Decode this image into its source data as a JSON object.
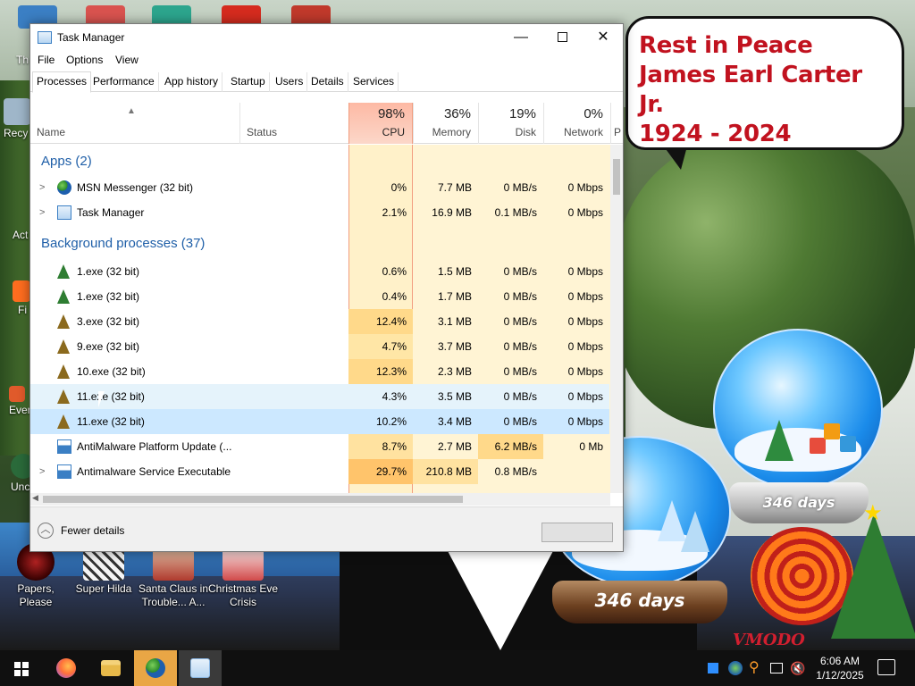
{
  "bubble": {
    "line1": "Rest in Peace",
    "line2": "James Earl Carter Jr.",
    "line3": "1924 - 2024"
  },
  "globes": {
    "left_label": "346 days",
    "right_label": "346 days"
  },
  "watermark": "VMODO",
  "desktop_icons": [
    {
      "label": "Papers, Please",
      "icon": "papers-please-icon",
      "color": "#8b0000"
    },
    {
      "label": "Super Hilda",
      "icon": "super-hilda-icon",
      "color": "#f4f4f4"
    },
    {
      "label": "Santa Claus in Trouble... A...",
      "icon": "santa-claus-icon",
      "color": "#b03a2e"
    },
    {
      "label": "Christmas Eve Crisis",
      "icon": "christmas-eve-icon",
      "color": "#d14a4a"
    }
  ],
  "left_icons": [
    {
      "label": "Th",
      "icon": "this-pc-icon"
    },
    {
      "label": "Recy",
      "icon": "recycle-bin-icon"
    },
    {
      "label": "Act",
      "icon": "activation-icon"
    },
    {
      "label": "Fi",
      "icon": "firefox-shortcut-icon"
    },
    {
      "label": "Ever",
      "icon": "everything-icon"
    },
    {
      "label": "Unc",
      "icon": "uncategorized-icon"
    }
  ],
  "window": {
    "title": "Task Manager",
    "menu": [
      "File",
      "Options",
      "View"
    ],
    "tabs": [
      "Processes",
      "Performance",
      "App history",
      "Startup",
      "Users",
      "Details",
      "Services"
    ],
    "active_tab": "Processes",
    "columns": {
      "name": "Name",
      "status": "Status",
      "cpu_pct": "98%",
      "cpu": "CPU",
      "mem_pct": "36%",
      "mem": "Memory",
      "disk_pct": "19%",
      "disk": "Disk",
      "net_pct": "0%",
      "net": "Network",
      "power": "P"
    },
    "groups": {
      "apps": "Apps (2)",
      "background": "Background processes (37)"
    },
    "apps": [
      {
        "name": "MSN Messenger (32 bit)",
        "cpu": "0%",
        "mem": "7.7 MB",
        "disk": "0 MB/s",
        "net": "0 Mbps",
        "icon": "msn-messenger-icon",
        "expandable": true
      },
      {
        "name": "Task Manager",
        "cpu": "2.1%",
        "mem": "16.9 MB",
        "disk": "0.1 MB/s",
        "net": "0 Mbps",
        "icon": "task-manager-icon",
        "expandable": true
      }
    ],
    "background": [
      {
        "name": "1.exe (32 bit)",
        "cpu": "0.6%",
        "mem": "1.5 MB",
        "disk": "0 MB/s",
        "net": "0 Mbps",
        "icon": "tree-icon",
        "expandable": false
      },
      {
        "name": "1.exe (32 bit)",
        "cpu": "0.4%",
        "mem": "1.7 MB",
        "disk": "0 MB/s",
        "net": "0 Mbps",
        "icon": "tree-icon",
        "expandable": false
      },
      {
        "name": "3.exe (32 bit)",
        "cpu": "12.4%",
        "mem": "3.1 MB",
        "disk": "0 MB/s",
        "net": "0 Mbps",
        "icon": "tree-icon",
        "expandable": false
      },
      {
        "name": "9.exe (32 bit)",
        "cpu": "4.7%",
        "mem": "3.7 MB",
        "disk": "0 MB/s",
        "net": "0 Mbps",
        "icon": "tree-icon",
        "expandable": false
      },
      {
        "name": "10.exe (32 bit)",
        "cpu": "12.3%",
        "mem": "2.3 MB",
        "disk": "0 MB/s",
        "net": "0 Mbps",
        "icon": "tree-icon",
        "expandable": false
      },
      {
        "name": "11.exe (32 bit)",
        "cpu": "4.3%",
        "mem": "3.5 MB",
        "disk": "0 MB/s",
        "net": "0 Mbps",
        "icon": "tree-icon",
        "expandable": false
      },
      {
        "name": "11.exe (32 bit)",
        "cpu": "10.2%",
        "mem": "3.4 MB",
        "disk": "0 MB/s",
        "net": "0 Mbps",
        "icon": "tree-icon",
        "expandable": false
      },
      {
        "name": "AntiMalware Platform Update (...",
        "cpu": "8.7%",
        "mem": "2.7 MB",
        "disk": "6.2 MB/s",
        "net": "0 Mb",
        "icon": "service-icon",
        "expandable": false
      },
      {
        "name": "Antimalware Service Executable",
        "cpu": "29.7%",
        "mem": "210.8 MB",
        "disk": "0.8 MB/s",
        "net": "",
        "icon": "service-icon",
        "expandable": true
      }
    ],
    "footer": {
      "fewer_details": "Fewer details"
    }
  },
  "taskbar": {
    "pinned": [
      {
        "name": "start-button",
        "icon": "windows-logo-icon"
      },
      {
        "name": "firefox",
        "icon": "firefox-icon"
      },
      {
        "name": "file-explorer",
        "icon": "folder-icon"
      },
      {
        "name": "msn-messenger",
        "icon": "msn-messenger-icon"
      },
      {
        "name": "task-manager",
        "icon": "task-manager-icon"
      }
    ],
    "time": "6:06 AM",
    "date": "1/12/2025"
  },
  "colors": {
    "accent_blue": "#1f5fa8",
    "cpu_header": "#fdb9a4",
    "bubble_text": "#c1121f",
    "taskbar": "#101010"
  }
}
